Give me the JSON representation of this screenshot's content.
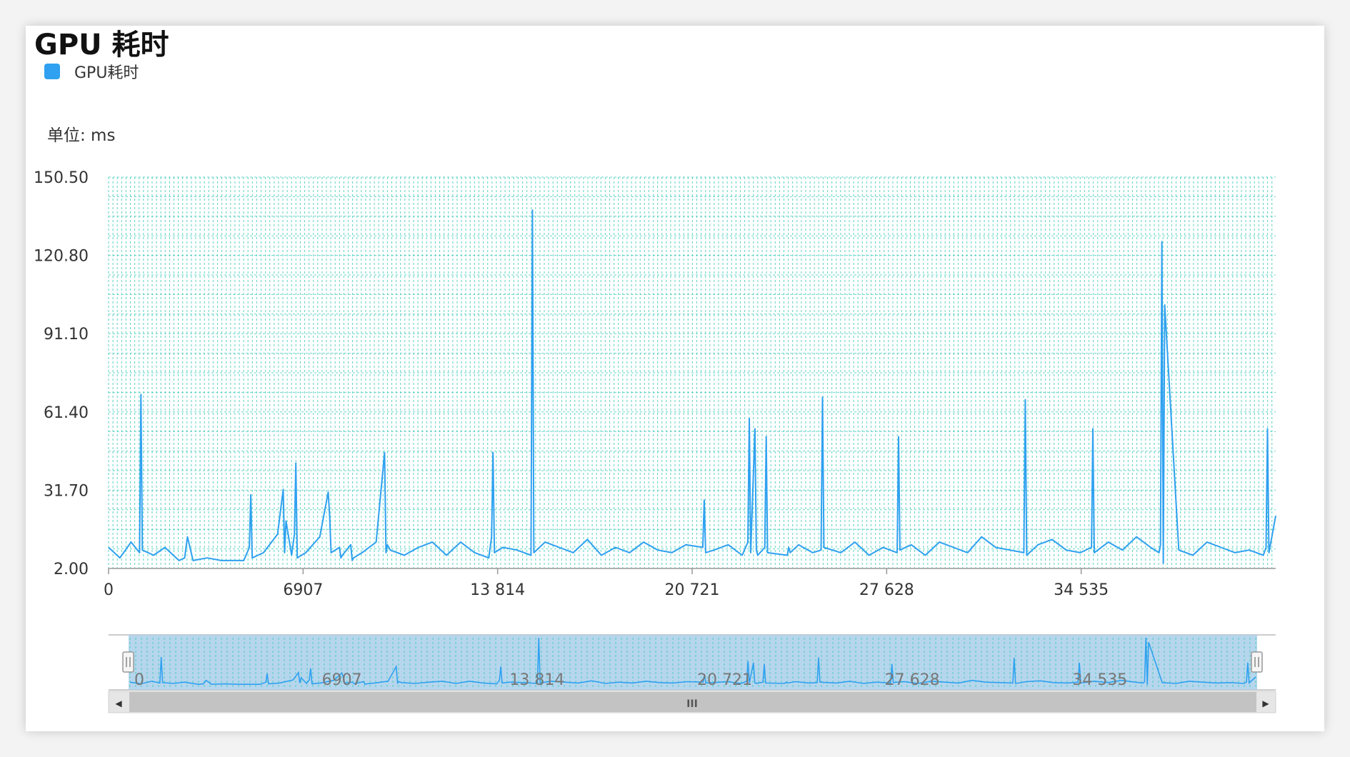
{
  "title": "GPU 耗时",
  "legend": {
    "label": "GPU耗时",
    "color": "#2fa1f0"
  },
  "unit_label": "单位: ms",
  "zoom_controls": {
    "handle_left": "handle-left",
    "handle_right": "handle-right",
    "scroll_thumb_glyph": "III",
    "arrow_left": "◀",
    "arrow_right": "▶"
  },
  "chart_data": {
    "type": "line",
    "title": "GPU 耗时",
    "ylabel": "单位: ms",
    "xlabel": "",
    "ylim": [
      2.0,
      150.5
    ],
    "xlim": [
      0,
      41442
    ],
    "yticks": [
      "2.00",
      "31.70",
      "61.40",
      "91.10",
      "120.80",
      "150.50"
    ],
    "xticks": [
      "0",
      "6907",
      "13 814",
      "20 721",
      "27 628",
      "34 535"
    ],
    "xtick_values": [
      0,
      6907,
      13814,
      20721,
      27628,
      34535
    ],
    "grid": true,
    "legend_position": "top-left",
    "line_color": "#2fa1f0",
    "grid_color": "#35c9b4",
    "series": [
      {
        "name": "GPU耗时",
        "x": [
          0,
          400,
          800,
          1100,
          1150,
          1200,
          1600,
          2000,
          2500,
          2700,
          2800,
          3000,
          3500,
          4000,
          4500,
          4800,
          5000,
          5050,
          5100,
          5500,
          6000,
          6200,
          6250,
          6300,
          6500,
          6600,
          6650,
          6700,
          7000,
          7500,
          7800,
          7850,
          7900,
          8200,
          8250,
          8300,
          8600,
          8650,
          8700,
          9000,
          9500,
          9800,
          9850,
          9900,
          10000,
          10500,
          11000,
          11500,
          12000,
          12500,
          13000,
          13500,
          13600,
          13650,
          13700,
          14000,
          14500,
          15000,
          15050,
          15100,
          15500,
          16000,
          16500,
          17000,
          17500,
          18000,
          18500,
          19000,
          19500,
          20000,
          20500,
          21100,
          21150,
          21200,
          21500,
          22000,
          22500,
          22700,
          22750,
          22800,
          22950,
          23000,
          23050,
          23300,
          23350,
          23400,
          24100,
          24150,
          24200,
          24500,
          25000,
          25300,
          25350,
          25400,
          26000,
          26500,
          27000,
          27500,
          28000,
          28050,
          28100,
          28500,
          29000,
          29500,
          30000,
          30500,
          31000,
          31500,
          32000,
          32500,
          32550,
          32600,
          33000,
          33500,
          34000,
          34500,
          34900,
          34950,
          35000,
          35500,
          36000,
          36500,
          37000,
          37300,
          37350,
          37400,
          37450,
          37500,
          38000,
          38500,
          39000,
          39500,
          40000,
          40500,
          41000,
          41100,
          41150,
          41200,
          41442
        ],
        "values": [
          10,
          6,
          12,
          8,
          68,
          9,
          7,
          10,
          5,
          6,
          14,
          5,
          6,
          5,
          5,
          5,
          10,
          30,
          6,
          8,
          15,
          32,
          8,
          20,
          7,
          15,
          42,
          6,
          8,
          14,
          31,
          22,
          8,
          10,
          6,
          7,
          11,
          5,
          6,
          8,
          12,
          46,
          8,
          11,
          9,
          7,
          10,
          12,
          7,
          12,
          8,
          6,
          14,
          46,
          8,
          10,
          9,
          7,
          138,
          8,
          12,
          10,
          8,
          13,
          7,
          10,
          8,
          12,
          9,
          8,
          11,
          10,
          28,
          8,
          9,
          11,
          7,
          12,
          59,
          8,
          55,
          9,
          7,
          10,
          52,
          8,
          7,
          10,
          8,
          11,
          8,
          9,
          67,
          10,
          8,
          12,
          7,
          10,
          8,
          52,
          9,
          11,
          7,
          12,
          10,
          8,
          14,
          10,
          9,
          8,
          66,
          7,
          11,
          13,
          9,
          8,
          10,
          55,
          8,
          12,
          9,
          14,
          10,
          8,
          11,
          126,
          4,
          102,
          9,
          7,
          12,
          10,
          8,
          9,
          7,
          10,
          55,
          8,
          22
        ]
      }
    ]
  }
}
